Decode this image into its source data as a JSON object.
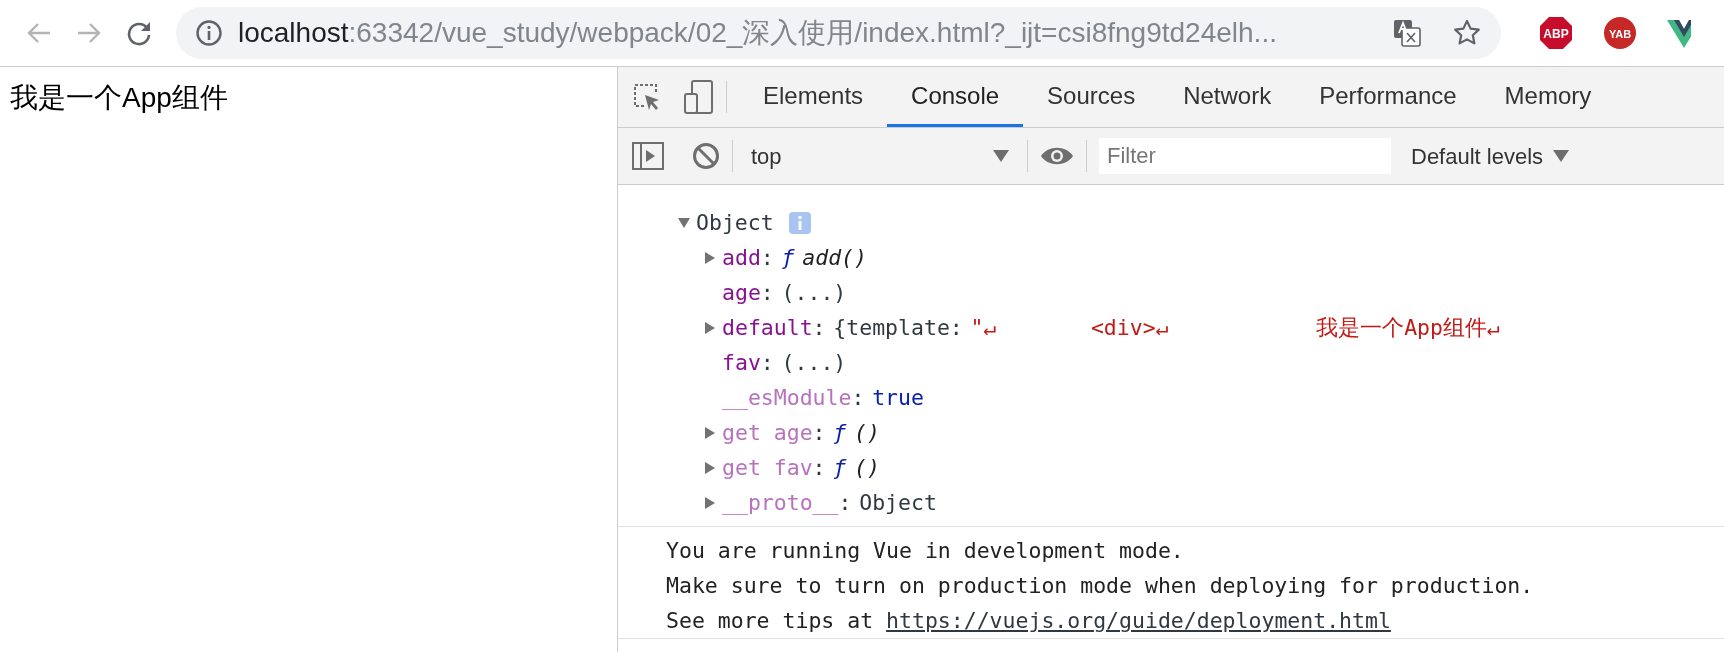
{
  "browser": {
    "back_disabled": true,
    "forward_disabled": true,
    "url_host": "localhost",
    "url_rest": ":63342/vue_study/webpack/02_深入使用/index.html?_ijt=csi8fng9td24elh...",
    "extensions": [
      {
        "kind": "abp",
        "label": "ABP"
      },
      {
        "kind": "yab",
        "label": "YAB"
      },
      {
        "kind": "vue"
      }
    ]
  },
  "page": {
    "text": "我是一个App组件"
  },
  "devtools": {
    "tabs": [
      {
        "label": "Elements",
        "selected": false
      },
      {
        "label": "Console",
        "selected": true
      },
      {
        "label": "Sources",
        "selected": false
      },
      {
        "label": "Network",
        "selected": false
      },
      {
        "label": "Performance",
        "selected": false
      },
      {
        "label": "Memory",
        "selected": false
      }
    ],
    "context": "top",
    "filter": {
      "placeholder": "Filter"
    },
    "levels": "Default levels"
  },
  "console": {
    "object": {
      "label": "Object",
      "expanded": true,
      "properties": [
        {
          "key": "add",
          "colon": ":",
          "dim": false,
          "expandable": true,
          "value": [
            {
              "kind": "fn-sign",
              "text": "ƒ"
            },
            {
              "kind": "fn-name",
              "text": "add()"
            }
          ]
        },
        {
          "key": "age",
          "colon": ":",
          "dim": false,
          "expandable": false,
          "value": [
            {
              "kind": "plain",
              "text": "(...)"
            }
          ]
        },
        {
          "key": "default",
          "colon": ":",
          "dim": false,
          "expandable": true,
          "value": [
            {
              "kind": "plain",
              "text": "{template:"
            },
            {
              "kind": "string",
              "text": "\"↵"
            },
            {
              "kind": "string",
              "text": "<div>↵"
            },
            {
              "kind": "string",
              "text": "我是一个App组件↵"
            }
          ]
        },
        {
          "key": "fav",
          "colon": ":",
          "dim": false,
          "expandable": false,
          "value": [
            {
              "kind": "plain",
              "text": "(...)"
            }
          ]
        },
        {
          "key": "__esModule",
          "colon": ":",
          "dim": true,
          "expandable": false,
          "value": [
            {
              "kind": "keyword",
              "text": "true"
            }
          ]
        },
        {
          "key": "get age",
          "colon": ":",
          "dim": true,
          "expandable": true,
          "value": [
            {
              "kind": "fn-sign",
              "text": "ƒ"
            },
            {
              "kind": "fn-name",
              "text": "()"
            }
          ]
        },
        {
          "key": "get fav",
          "colon": ":",
          "dim": true,
          "expandable": true,
          "value": [
            {
              "kind": "fn-sign",
              "text": "ƒ"
            },
            {
              "kind": "fn-name",
              "text": "()"
            }
          ]
        },
        {
          "key": "__proto__",
          "colon": ":",
          "dim": true,
          "expandable": true,
          "value": [
            {
              "kind": "plain",
              "text": "Object"
            }
          ]
        }
      ]
    },
    "message": {
      "lines": [
        "You are running Vue in development mode.",
        "Make sure to turn on production mode when deploying for production."
      ],
      "link_prefix": "See more tips at",
      "link": "https://vuejs.org/guide/deployment.html"
    }
  }
}
